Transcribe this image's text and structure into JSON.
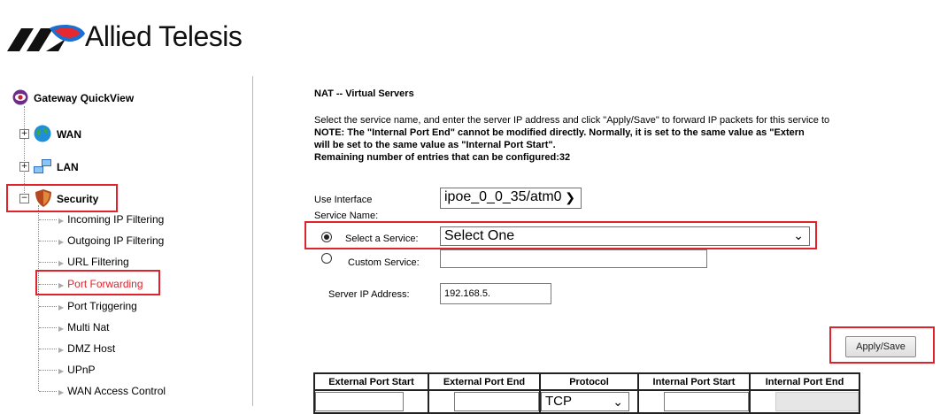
{
  "brand": {
    "name": "Allied Telesis"
  },
  "sidebar": {
    "gateway": "Gateway QuickView",
    "wan": "WAN",
    "lan": "LAN",
    "security": "Security",
    "items": [
      {
        "label": "Incoming IP Filtering"
      },
      {
        "label": "Outgoing IP Filtering"
      },
      {
        "label": "URL Filtering"
      },
      {
        "label": "Port Forwarding",
        "active": true
      },
      {
        "label": "Port Triggering"
      },
      {
        "label": "Multi Nat"
      },
      {
        "label": "DMZ Host"
      },
      {
        "label": "UPnP"
      },
      {
        "label": "WAN Access Control"
      }
    ]
  },
  "main": {
    "title": "NAT -- Virtual Servers",
    "description": "Select the service name, and enter the server IP address and click \"Apply/Save\" to forward IP packets for this service to",
    "note1": "NOTE: The \"Internal Port End\" cannot be modified directly. Normally, it is set to the same value as \"Extern",
    "note2": "will be set to the same value as \"Internal Port Start\".",
    "remaining": "Remaining number of entries that can be configured:32",
    "use_interface_label": "Use Interface",
    "use_interface_value": "ipoe_0_0_35/atm0",
    "service_name_label": "Service Name:",
    "select_service_label": "Select a Service:",
    "select_service_value": "Select One",
    "custom_service_label": "Custom Service:",
    "custom_service_value": "",
    "server_ip_label": "Server IP Address:",
    "server_ip_value": "192.168.5.",
    "apply_label": "Apply/Save",
    "table": {
      "headers": [
        "External Port Start",
        "External Port End",
        "Protocol",
        "Internal Port Start",
        "Internal Port End"
      ],
      "protocol_value": "TCP"
    }
  },
  "colors": {
    "highlight": "#e0222a",
    "active_link": "#e0222a"
  }
}
